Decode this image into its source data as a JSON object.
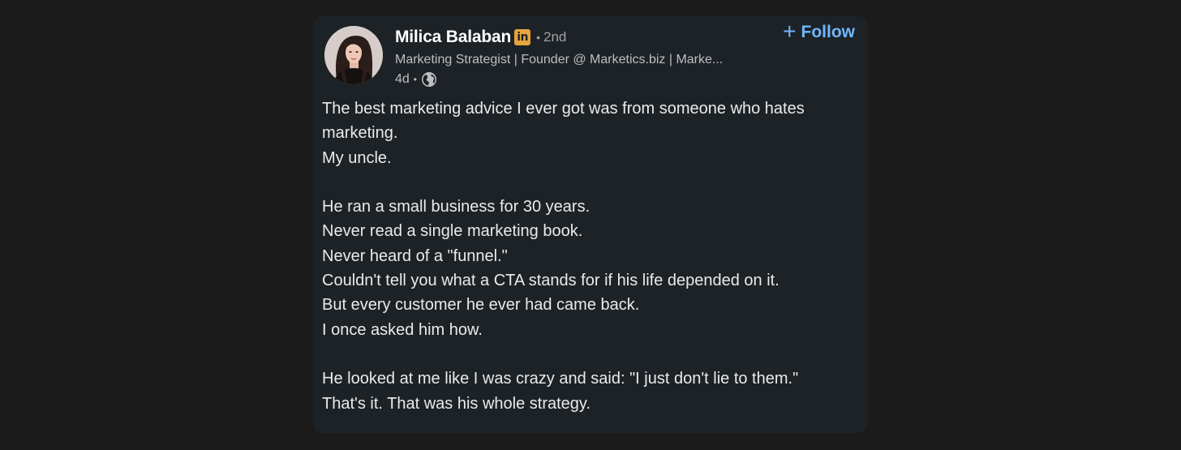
{
  "post": {
    "author": {
      "name": "Milica Balaban",
      "badge": "in",
      "degree": "2nd",
      "headline": "Marketing Strategist | Founder @ Marketics.biz | Marke...",
      "time": "4d",
      "avatar": "profile-photo"
    },
    "follow_label": "Follow",
    "follow_icon": "plus-icon",
    "visibility_icon": "globe-icon",
    "colors": {
      "background": "#1b1b1b",
      "card": "#1d2226",
      "accent": "#71b7fb",
      "badge": "#e7a33e"
    },
    "body_lines": [
      "The best marketing advice I ever got was from someone who hates",
      "marketing.",
      "My uncle.",
      "",
      "He ran a small business for 30 years.",
      "Never read a single marketing book.",
      "Never heard of a \"funnel.\"",
      "Couldn't tell you what a CTA stands for if his life depended on it.",
      "But every customer he ever had came back.",
      "I once asked him how.",
      "",
      "He looked at me like I was crazy and said: \"I just don't lie to them.\"",
      "That's it. That was his whole strategy."
    ]
  }
}
